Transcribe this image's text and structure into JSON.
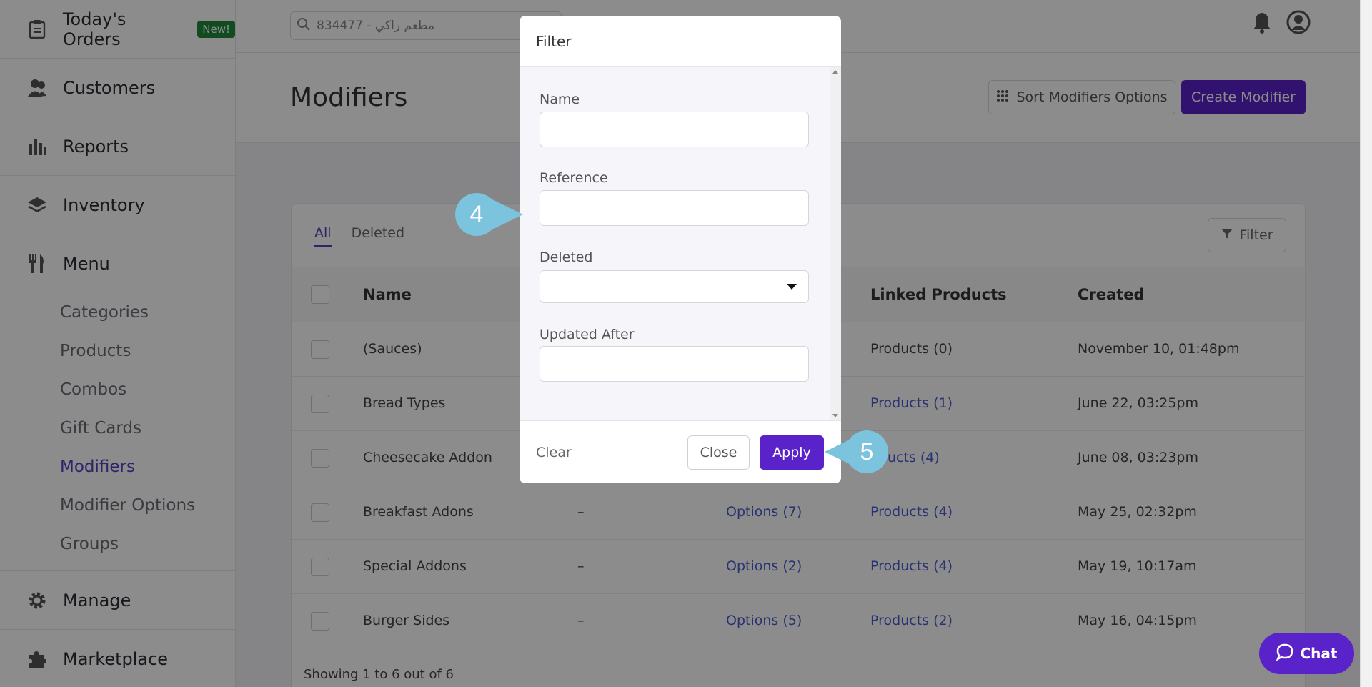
{
  "sidebar": {
    "items": [
      {
        "label": "Today's Orders",
        "badge": "New!",
        "icon": "clipboard-icon"
      },
      {
        "label": "Customers",
        "icon": "users-icon"
      },
      {
        "label": "Reports",
        "icon": "bar-chart-icon"
      },
      {
        "label": "Inventory",
        "icon": "layers-icon"
      },
      {
        "label": "Menu",
        "icon": "utensils-icon"
      }
    ],
    "menu_sub": [
      "Categories",
      "Products",
      "Combos",
      "Gift Cards",
      "Modifiers",
      "Modifier Options",
      "Groups"
    ],
    "active_sub": "Modifiers",
    "bottom_items": [
      {
        "label": "Manage",
        "icon": "gear-icon"
      },
      {
        "label": "Marketplace",
        "icon": "puzzle-icon"
      }
    ]
  },
  "topbar": {
    "search_value": "مطعم زاكي - 834477"
  },
  "page": {
    "title": "Modifiers",
    "sort_button": "Sort Modifiers Options",
    "create_button": "Create Modifier"
  },
  "list": {
    "tabs": [
      "All",
      "Deleted"
    ],
    "active_tab": "All",
    "filter_button": "Filter",
    "columns": [
      "Name",
      "Linked Products",
      "Created"
    ],
    "rows": [
      {
        "name": "(Sauces)",
        "reference": "",
        "options": "",
        "products": "Products (0)",
        "products_link": false,
        "created": "November 10, 01:48pm"
      },
      {
        "name": "Bread Types",
        "reference": "",
        "options": "",
        "products": "Products (1)",
        "products_link": true,
        "created": "June 22, 03:25pm"
      },
      {
        "name": "Cheesecake Addon",
        "reference": "",
        "options": "",
        "products": "ucts (4)",
        "products_link": true,
        "created": "June 08, 03:23pm"
      },
      {
        "name": "Breakfast Adons",
        "reference": "–",
        "options": "Options (7)",
        "products": "Products (4)",
        "products_link": true,
        "created": "May 25, 02:32pm"
      },
      {
        "name": "Special Addons",
        "reference": "–",
        "options": "Options (2)",
        "products": "Products (4)",
        "products_link": true,
        "created": "May 19, 10:17am"
      },
      {
        "name": "Burger Sides",
        "reference": "–",
        "options": "Options (5)",
        "products": "Products (2)",
        "products_link": true,
        "created": "May 16, 04:15pm"
      }
    ],
    "footer": "Showing 1 to 6 out of 6"
  },
  "modal": {
    "title": "Filter",
    "fields": [
      {
        "label": "Name",
        "type": "text",
        "value": ""
      },
      {
        "label": "Reference",
        "type": "text",
        "value": ""
      },
      {
        "label": "Deleted",
        "type": "select",
        "value": ""
      },
      {
        "label": "Updated After",
        "type": "text",
        "value": ""
      }
    ],
    "clear_button": "Clear",
    "close_button": "Close",
    "apply_button": "Apply"
  },
  "callouts": [
    "4",
    "5"
  ],
  "chat": {
    "label": "Chat"
  },
  "colors": {
    "accent": "#5a22c9",
    "callout": "#7cc3de",
    "link": "#4a5bd0",
    "badge": "#1f8a3b"
  }
}
